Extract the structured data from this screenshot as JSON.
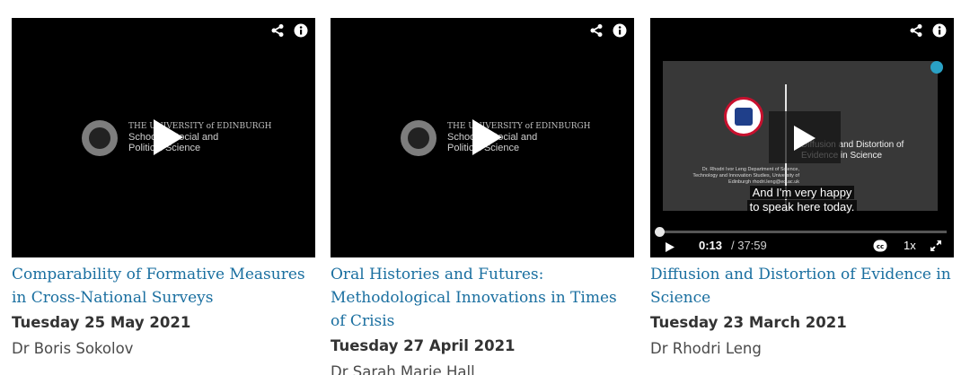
{
  "videos": [
    {
      "title": "Comparability of Formative Measures in Cross-National Surveys",
      "date": "Tuesday 25 May 2021",
      "speaker": "Dr Boris Sokolov",
      "brand": {
        "line1": "THE UNIVERSITY of EDINBURGH",
        "line2": "School of Social and",
        "line3": "Political Science"
      }
    },
    {
      "title": "Oral Histories and Futures: Methodological Innovations in Times of Crisis",
      "date": "Tuesday 27 April 2021",
      "speaker": "Dr Sarah Marie Hall",
      "brand": {
        "line1": "THE UNIVERSITY of EDINBURGH",
        "line2": "School of Social and",
        "line3": "Political Science"
      }
    },
    {
      "title": "Diffusion and Distortion of Evidence in Science",
      "date": "Tuesday 23 March 2021",
      "speaker": "Dr Rhodri Leng",
      "slide": {
        "title_line1": "Diffusion and Distortion of",
        "title_line2": "Evidence in Science",
        "author": "Dr. Rhodri Ivor Leng Department of Science, Technology and Innovation Studies, University of Edinburgh rhodri.leng@ed.ac.uk"
      },
      "caption_line1": "And I'm very happy",
      "caption_line2": "to speak here today.",
      "player": {
        "current_time": "0:13",
        "total_time": "/ 37:59",
        "speed": "1x",
        "progress_fraction": 0.0057
      }
    }
  ],
  "icons": [
    "share-icon",
    "info-icon",
    "play-icon",
    "closed-captions-icon",
    "fullscreen-icon"
  ],
  "colors": {
    "link": "#1a6fa0",
    "player_bg": "#000000",
    "slide_bg": "#383838",
    "accent_dot": "#2aa1c5"
  }
}
